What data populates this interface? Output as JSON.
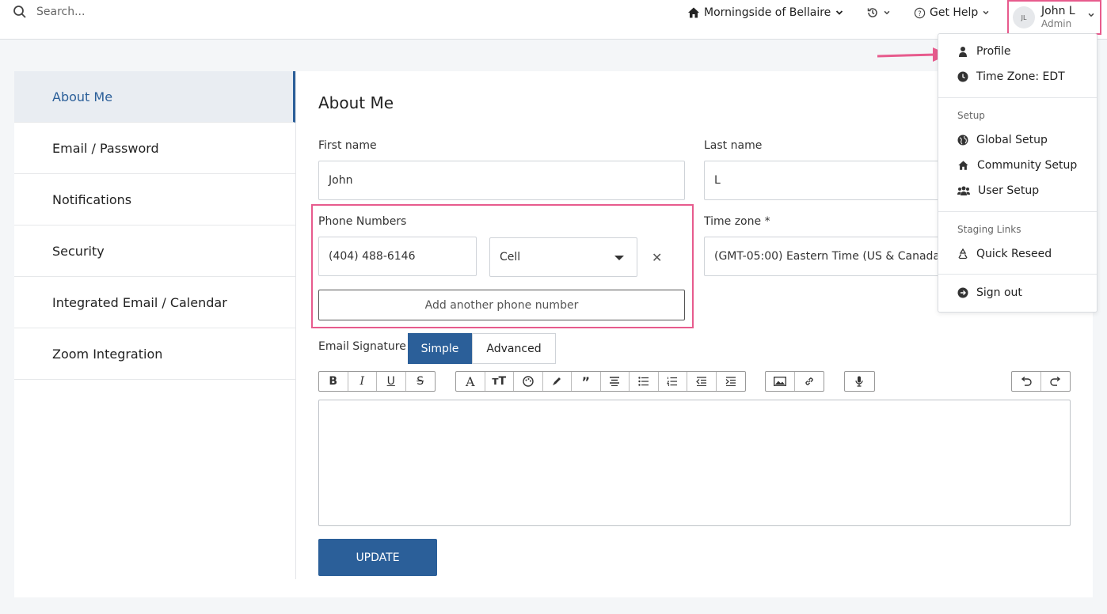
{
  "topbar": {
    "search_placeholder": "Search...",
    "community": "Morningside of Bellaire",
    "help": "Get Help",
    "user": {
      "initials": "JL",
      "name": "John L",
      "role": "Admin"
    }
  },
  "sidebar": {
    "items": [
      {
        "label": "About Me",
        "active": true
      },
      {
        "label": "Email / Password"
      },
      {
        "label": "Notifications"
      },
      {
        "label": "Security"
      },
      {
        "label": "Integrated Email / Calendar"
      },
      {
        "label": "Zoom Integration"
      }
    ]
  },
  "form": {
    "title": "About Me",
    "first_name_label": "First name",
    "first_name": "John",
    "last_name_label": "Last name",
    "last_name": "L",
    "phone_label": "Phone Numbers",
    "phone": "(404) 488-6146",
    "phone_type": "Cell",
    "add_phone": "Add another phone number",
    "timezone_label": "Time zone *",
    "timezone": "(GMT-05:00) Eastern Time (US & Canada)",
    "signature_label": "Email Signature",
    "mode_simple": "Simple",
    "mode_advanced": "Advanced",
    "update": "UPDATE"
  },
  "menu": {
    "profile": "Profile",
    "timezone": "Time Zone: EDT",
    "setup_header": "Setup",
    "global_setup": "Global Setup",
    "community_setup": "Community Setup",
    "user_setup": "User Setup",
    "staging_header": "Staging Links",
    "quick_reseed": "Quick Reseed",
    "sign_out": "Sign out"
  },
  "colors": {
    "accent": "#2b5f99",
    "highlight": "#e75b8d"
  }
}
